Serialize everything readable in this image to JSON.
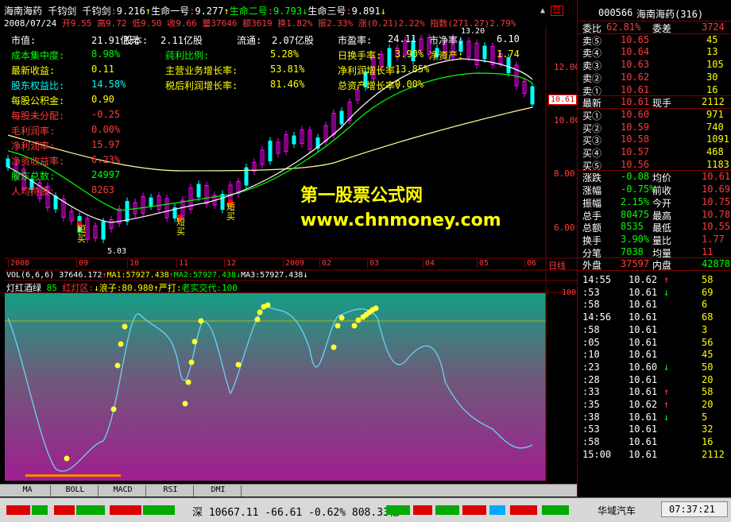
{
  "header": {
    "stock": "海南海药",
    "tool": "千钧剑",
    "ind_label": "千钧剑",
    "ind_value": "9.216",
    "l1_label": "生命一号",
    "l1_value": "9.277",
    "l2_label": "生命二号",
    "l2_value": "9.793",
    "l3_label": "生命三号",
    "l3_value": "9.891"
  },
  "bar": {
    "date": "2008/07/24",
    "open": "开9.55",
    "high": "高9.72",
    "low": "低9.50",
    "close": "收9.66",
    "vol": "量37646",
    "amount": "额3619",
    "turn": "换1.82%",
    "amp": "振2.33%",
    "chg": "涨(0.21)2.22%",
    "index": "指数(271.27)2.79%"
  },
  "fundamentals": [
    {
      "label": "市值:",
      "value": "21.91亿元",
      "col": 0,
      "row": 0,
      "lc": "w"
    },
    {
      "label": "股本:",
      "value": "2.11亿股",
      "col": 1,
      "row": 0,
      "lc": "w"
    },
    {
      "label": "流通:",
      "value": "2.07亿股",
      "col": 2,
      "row": 0,
      "lc": "w"
    },
    {
      "label": "市盈率:",
      "value": "24.11",
      "col": 3,
      "row": 0,
      "lc": "w"
    },
    {
      "label": "市净率:",
      "value": "6.10",
      "col": 4,
      "row": 0,
      "lc": "w"
    },
    {
      "label": "成本集中度:",
      "value": "8.98%",
      "col": 0,
      "row": 1,
      "lc": "g"
    },
    {
      "label": "莼利比例:",
      "value": "5.28%",
      "col": 1,
      "row": 1,
      "lc": "g"
    },
    {
      "label": "日换手率:",
      "value": "3.90%",
      "col": 3,
      "row": 1,
      "lc": "y"
    },
    {
      "label": "净资产:",
      "value": "1.74",
      "col": 4,
      "row": 1,
      "lc": "y"
    },
    {
      "label": "最新收益:",
      "value": "0.11",
      "col": 0,
      "row": 2,
      "lc": "y"
    },
    {
      "label": "主营业务增长率:",
      "value": "53.81%",
      "col": 1,
      "row": 2,
      "lc": "y"
    },
    {
      "label": "净利润增长率:",
      "value": "13.85%",
      "col": 3,
      "row": 2,
      "lc": "y"
    },
    {
      "label": "股东权益比:",
      "value": "14.58%",
      "col": 0,
      "row": 3,
      "lc": "c"
    },
    {
      "label": "税后利润增长率:",
      "value": "81.46%",
      "col": 1,
      "row": 3,
      "lc": "y"
    },
    {
      "label": "总资产增长率:",
      "value": "0.00%",
      "col": 3,
      "row": 3,
      "lc": "y"
    },
    {
      "label": "每股公积金:",
      "value": "0.90",
      "col": 0,
      "row": 4,
      "lc": "y"
    },
    {
      "label": "每股未分配:",
      "value": "-0.25",
      "col": 0,
      "row": 5,
      "lc": "r"
    },
    {
      "label": "毛利润率:",
      "value": "0.00%",
      "col": 0,
      "row": 6,
      "lc": "r"
    },
    {
      "label": "净利润率:",
      "value": "15.97",
      "col": 0,
      "row": 7,
      "lc": "r"
    },
    {
      "label": "净资收益率:",
      "value": "6.23%",
      "col": 0,
      "row": 8,
      "lc": "r"
    },
    {
      "label": "股东总数:",
      "value": "24997",
      "col": 0,
      "row": 9,
      "lc": "g"
    },
    {
      "label": "人均持股:",
      "value": "8263",
      "col": 0,
      "row": 10,
      "lc": "r"
    }
  ],
  "chart_labels": {
    "high_label": "13.20",
    "low_label": "5.03",
    "buy_label": "短买",
    "current_price": "10.61"
  },
  "price_axis": [
    "12.00",
    "10.00",
    "8.00",
    "6.00"
  ],
  "date_axis": [
    "2008",
    "09",
    "10",
    "11",
    "12",
    "2009",
    "02",
    "03",
    "04",
    "05",
    "06"
  ],
  "date_axis_right": "日线",
  "vol_line": {
    "label": "VOL(6,6,6)",
    "v1": "37646.172",
    "ma1": "MA1:57927.438",
    "ma2": "MA2:57927.438",
    "ma3": "MA3:57927.438"
  },
  "ind_line": {
    "name": "灯红酒绿",
    "p": "85",
    "a": "红灯区:",
    "b": "浪子:80.980",
    "c": "严打:",
    "d": "老实交代:100"
  },
  "lower_axis": "100",
  "watermark": {
    "cn": "第一股票公式网",
    "url": "www.chnmoney.com"
  },
  "tabs": [
    "MA",
    "BOLL",
    "MACD",
    "RSI",
    "DMI"
  ],
  "quote": {
    "code": "000566",
    "name": "海南海药(316)",
    "wb_label": "委比",
    "wb": "62.81%",
    "wc_label": "委差",
    "wc": "3724",
    "sells": [
      {
        "l": "卖⑤",
        "p": "10.65",
        "v": "45"
      },
      {
        "l": "卖④",
        "p": "10.64",
        "v": "13"
      },
      {
        "l": "卖③",
        "p": "10.63",
        "v": "105"
      },
      {
        "l": "卖②",
        "p": "10.62",
        "v": "30"
      },
      {
        "l": "卖①",
        "p": "10.61",
        "v": "16"
      }
    ],
    "last_label": "最新",
    "last": "10.61",
    "now_label": "现手",
    "now": "2112",
    "buys": [
      {
        "l": "买①",
        "p": "10.60",
        "v": "971"
      },
      {
        "l": "买②",
        "p": "10.59",
        "v": "740"
      },
      {
        "l": "买③",
        "p": "10.58",
        "v": "1091"
      },
      {
        "l": "买④",
        "p": "10.57",
        "v": "468"
      },
      {
        "l": "买⑤",
        "p": "10.56",
        "v": "1183"
      }
    ],
    "stats": [
      [
        "涨跌",
        "-0.08",
        "均价",
        "10.61"
      ],
      [
        "涨幅",
        "-0.75%",
        "前收",
        "10.69"
      ],
      [
        "振幅",
        "2.15%",
        "今开",
        "10.75"
      ],
      [
        "总手",
        "80475",
        "最高",
        "10.78"
      ],
      [
        "总额",
        "8535",
        "最低",
        "10.55"
      ],
      [
        "换手",
        "3.90%",
        "量比",
        "1.77"
      ],
      [
        "分笔",
        "7038",
        "均量",
        "11"
      ]
    ],
    "outer_label": "外盘",
    "outer": "37597",
    "inner_label": "内盘",
    "inner": "42878",
    "ticks": [
      [
        "14:55",
        "10.62",
        "↑",
        "58"
      ],
      [
        ":53",
        "10.61",
        "↓",
        "69"
      ],
      [
        ":58",
        "10.61",
        "",
        "6"
      ],
      [
        "14:56",
        "10.61",
        "",
        "68"
      ],
      [
        ":58",
        "10.61",
        "",
        "3"
      ],
      [
        ":05",
        "10.61",
        "",
        "56"
      ],
      [
        ":10",
        "10.61",
        "",
        "45"
      ],
      [
        ":23",
        "10.60",
        "↓",
        "50"
      ],
      [
        ":28",
        "10.61",
        "",
        "20"
      ],
      [
        ":33",
        "10.61",
        "↑",
        "58"
      ],
      [
        ":35",
        "10.62",
        "↑",
        "20"
      ],
      [
        ":38",
        "10.61",
        "↓",
        "5"
      ],
      [
        ":53",
        "10.61",
        "",
        "32"
      ],
      [
        ":58",
        "10.61",
        "",
        "16"
      ],
      [
        "15:00",
        "10.61",
        "",
        "2112"
      ]
    ]
  },
  "status": {
    "index_name": "深",
    "index_value": "10667.11",
    "index_chg": "-66.61",
    "index_pct": "-0.62%",
    "index_amt": "808.33亿",
    "stock": "华域汽车",
    "time": "07:37:21"
  }
}
